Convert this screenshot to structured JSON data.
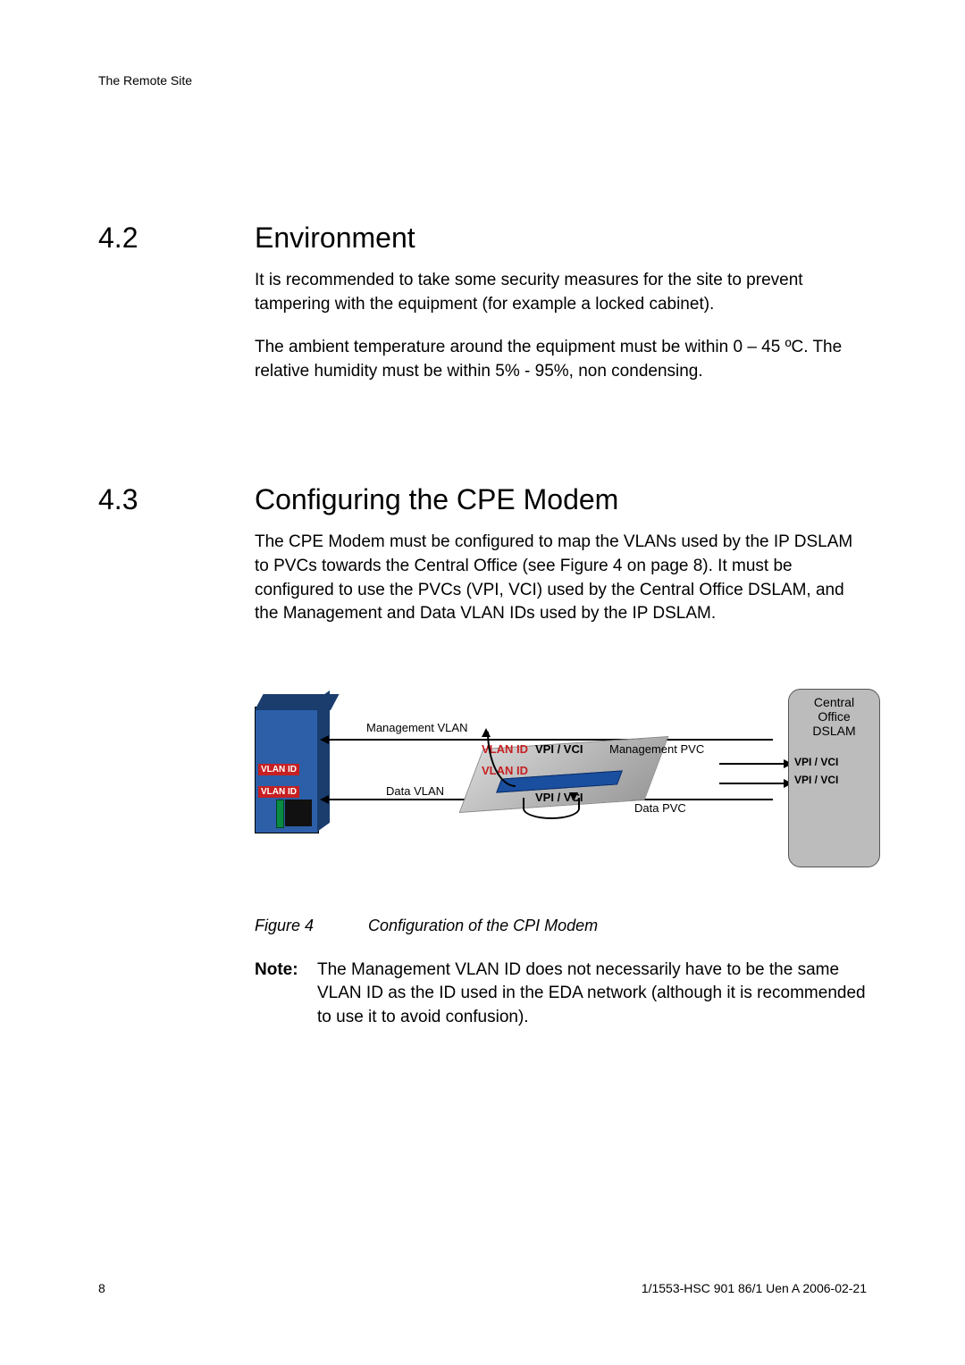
{
  "header": "The Remote Site",
  "sections": [
    {
      "num": "4.2",
      "title": "Environment",
      "paragraphs": [
        "It is recommended to take some security measures for the site to prevent tampering with the equipment (for example a locked cabinet).",
        "The ambient temperature around the equipment must be within 0 – 45 ºC. The relative humidity must be within 5% - 95%, non condensing."
      ]
    },
    {
      "num": "4.3",
      "title": "Configuring the CPE Modem",
      "paragraphs": [
        "The CPE Modem must be configured to map the VLANs used by the IP DSLAM to PVCs towards the Central Office (see Figure 4 on page 8). It must be configured to use the PVCs (VPI, VCI) used by the Central Office DSLAM, and the Management and Data VLAN IDs used by the IP DSLAM."
      ]
    }
  ],
  "figure": {
    "dslam_vlan_tag1": "VLAN ID",
    "dslam_vlan_tag2": "VLAN ID",
    "mgmt_vlan": "Management VLAN",
    "data_vlan": "Data VLAN",
    "vlan_id_top": "VLAN ID",
    "vlan_id_bottom": "VLAN ID",
    "vpi_vci_top": "VPI / VCI",
    "vpi_vci_bottom": "VPI / VCI",
    "mgmt_pvc": "Management PVC",
    "data_pvc": "Data PVC",
    "central_l1": "Central",
    "central_l2": "Office",
    "central_l3": "DSLAM",
    "central_vpivci1": "VPI / VCI",
    "central_vpivci2": "VPI / VCI",
    "caption_num": "Figure 4",
    "caption_text": "Configuration of the CPI Modem"
  },
  "note": {
    "label": "Note:",
    "text": "The Management VLAN ID does not necessarily have to be the same VLAN ID as the ID used in the EDA network (although it is recommended to use it to avoid confusion)."
  },
  "footer": {
    "page": "8",
    "docid": "1/1553-HSC 901 86/1 Uen A   2006-02-21"
  }
}
